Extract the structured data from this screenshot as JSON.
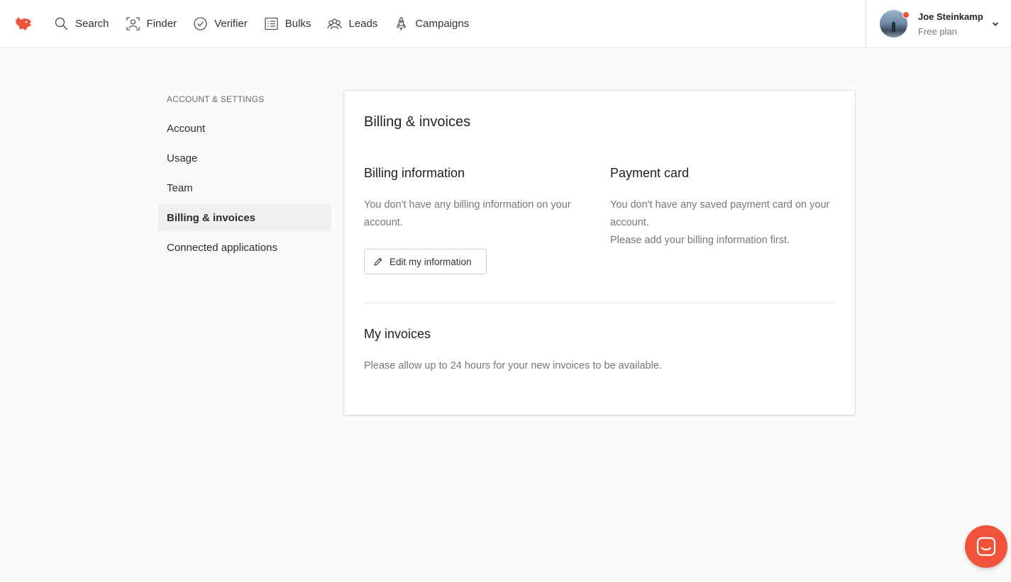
{
  "nav": {
    "items": [
      {
        "label": "Search",
        "icon": "search-icon"
      },
      {
        "label": "Finder",
        "icon": "finder-icon"
      },
      {
        "label": "Verifier",
        "icon": "verifier-icon"
      },
      {
        "label": "Bulks",
        "icon": "bulks-icon"
      },
      {
        "label": "Leads",
        "icon": "leads-icon"
      },
      {
        "label": "Campaigns",
        "icon": "campaigns-icon"
      }
    ]
  },
  "user": {
    "name": "Joe Steinkamp",
    "plan": "Free plan"
  },
  "sidebar": {
    "heading": "ACCOUNT & SETTINGS",
    "items": [
      {
        "label": "Account"
      },
      {
        "label": "Usage"
      },
      {
        "label": "Team"
      },
      {
        "label": "Billing & invoices",
        "active": true
      },
      {
        "label": "Connected applications"
      }
    ]
  },
  "main": {
    "title": "Billing & invoices",
    "billing": {
      "title": "Billing information",
      "text_line1": "You don't have any billing information on your",
      "text_line2": "account.",
      "edit_label": "Edit my information"
    },
    "payment": {
      "title": "Payment card",
      "text_line1": "You don't have any saved payment card on your",
      "text_line2": "account.",
      "text_line3": "Please add your billing information first."
    },
    "invoices": {
      "title": "My invoices",
      "text": "Please allow up to 24 hours for your new invoices to be available."
    }
  },
  "colors": {
    "brand": "#f0533a",
    "background": "#f9faf9"
  }
}
